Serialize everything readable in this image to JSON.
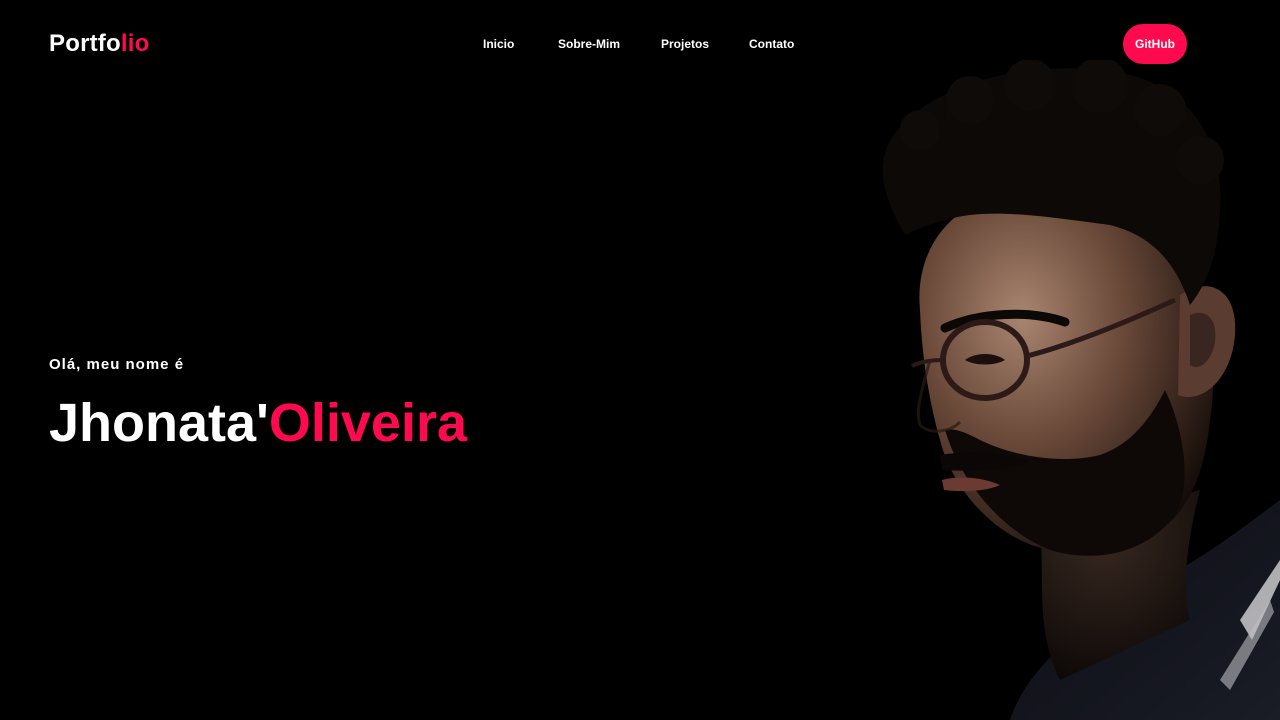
{
  "brand": {
    "logo_main": "Portfo",
    "logo_accent": "lio"
  },
  "nav": {
    "items": [
      "Inicio",
      "Sobre-Mim",
      "Projetos",
      "Contato"
    ]
  },
  "cta": {
    "github_label": "GitHub"
  },
  "hero": {
    "greeting": "Olá, meu nome é",
    "name_first": "Jhonata'",
    "name_last": "Oliveira"
  },
  "colors": {
    "accent": "#ff0a4e",
    "background": "#000000",
    "text": "#ffffff"
  },
  "icons": {
    "portrait": "person-portrait"
  }
}
